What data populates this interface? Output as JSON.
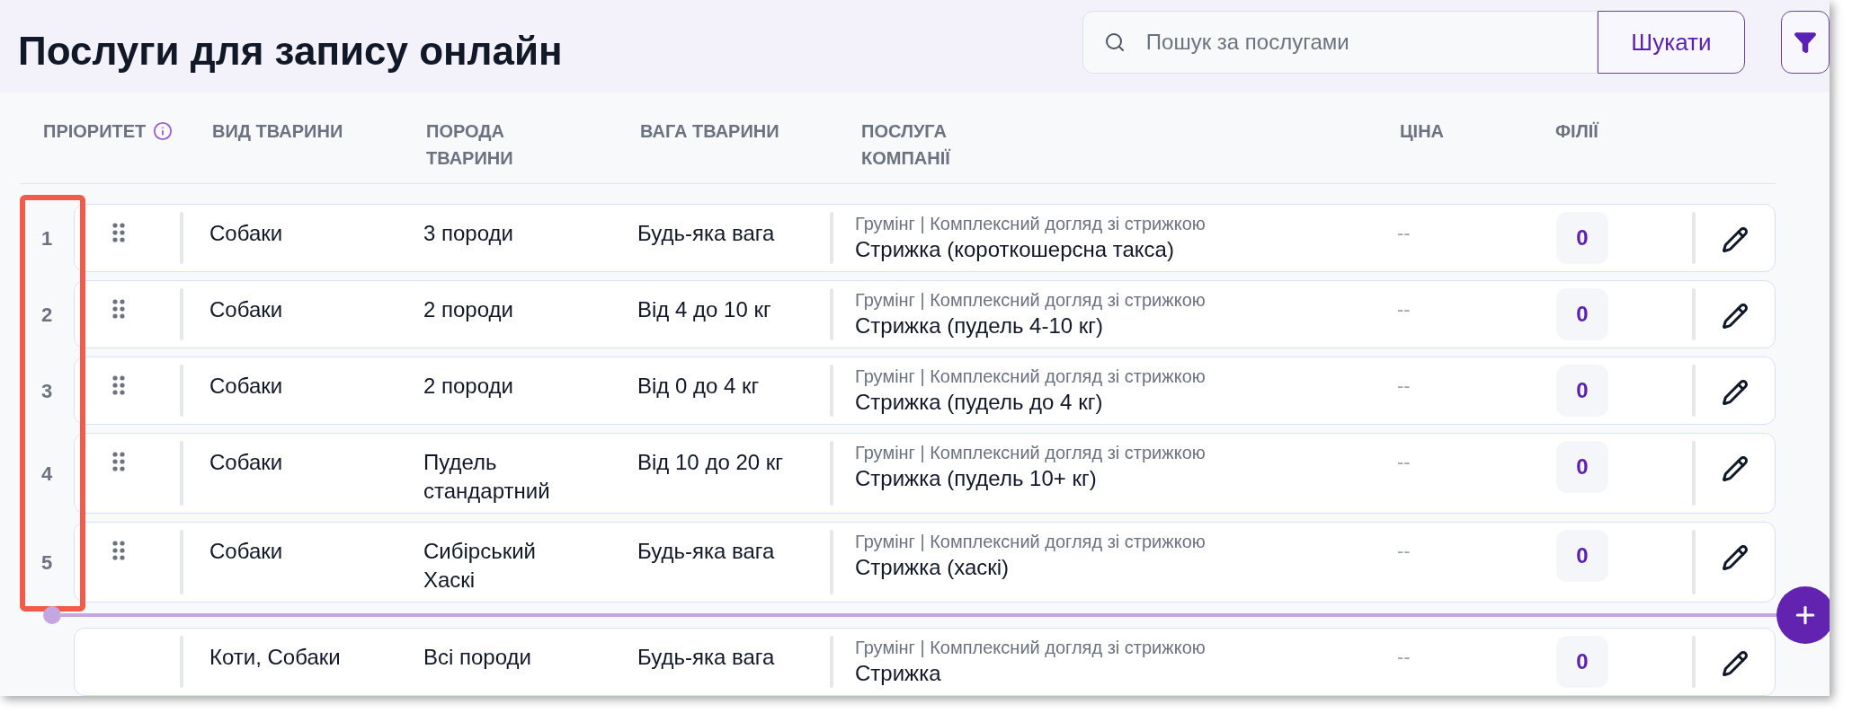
{
  "title": "Послуги для запису онлайн",
  "search": {
    "placeholder": "Пошук за послугами",
    "button": "Шукати"
  },
  "table": {
    "columns": [
      {
        "label": "ПРІОРИТЕТ",
        "info": true
      },
      {
        "label": "ВИД ТВАРИНИ",
        "info": false
      },
      {
        "label": "ПОРОДА ТВАРИНИ",
        "info": false
      },
      {
        "label": "ВАГА ТВАРИНИ",
        "info": false
      },
      {
        "label": "ПОСЛУГА КОМПАНІЇ",
        "info": false
      },
      {
        "label": "ЦІНА",
        "info": false
      },
      {
        "label": "ФІЛІЇ",
        "info": false
      }
    ],
    "priority_highlight": true,
    "rows": [
      {
        "priority": "1",
        "draggable": true,
        "separated": false,
        "animal": "Собаки",
        "breed": "3 породи",
        "weight": "Будь-яка вага",
        "category": "Грумінг | Комплексний догляд зі стрижкою",
        "service": "Стрижка (короткошерсна такса)",
        "price": "--",
        "branches": "0"
      },
      {
        "priority": "2",
        "draggable": true,
        "separated": false,
        "animal": "Собаки",
        "breed": "2 породи",
        "weight": "Від 4 до 10 кг",
        "category": "Грумінг | Комплексний догляд зі стрижкою",
        "service": "Стрижка (пудель 4-10 кг)",
        "price": "--",
        "branches": "0"
      },
      {
        "priority": "3",
        "draggable": true,
        "separated": false,
        "animal": "Собаки",
        "breed": "2 породи",
        "weight": "Від 0 до 4 кг",
        "category": "Грумінг | Комплексний догляд зі стрижкою",
        "service": "Стрижка (пудель до 4 кг)",
        "price": "--",
        "branches": "0"
      },
      {
        "priority": "4",
        "draggable": true,
        "separated": false,
        "animal": "Собаки",
        "breed": "Пудель стандартний",
        "weight": "Від 10 до 20 кг",
        "category": "Грумінг | Комплексний догляд зі стрижкою",
        "service": "Стрижка (пудель 10+ кг)",
        "price": "--",
        "branches": "0"
      },
      {
        "priority": "5",
        "draggable": true,
        "separated": false,
        "animal": "Собаки",
        "breed": "Сибірський Хаскі",
        "weight": "Будь-яка вага",
        "category": "Грумінг | Комплексний догляд зі стрижкою",
        "service": "Стрижка (хаскі)",
        "price": "--",
        "branches": "0"
      },
      {
        "draggable": false,
        "separated": true,
        "animal": "Коти, Собаки",
        "breed": "Всі породи",
        "weight": "Будь-яка вага",
        "category": "Грумінг | Комплексний догляд зі стрижкою",
        "service": "Стрижка",
        "price": "--",
        "branches": "0"
      }
    ]
  }
}
